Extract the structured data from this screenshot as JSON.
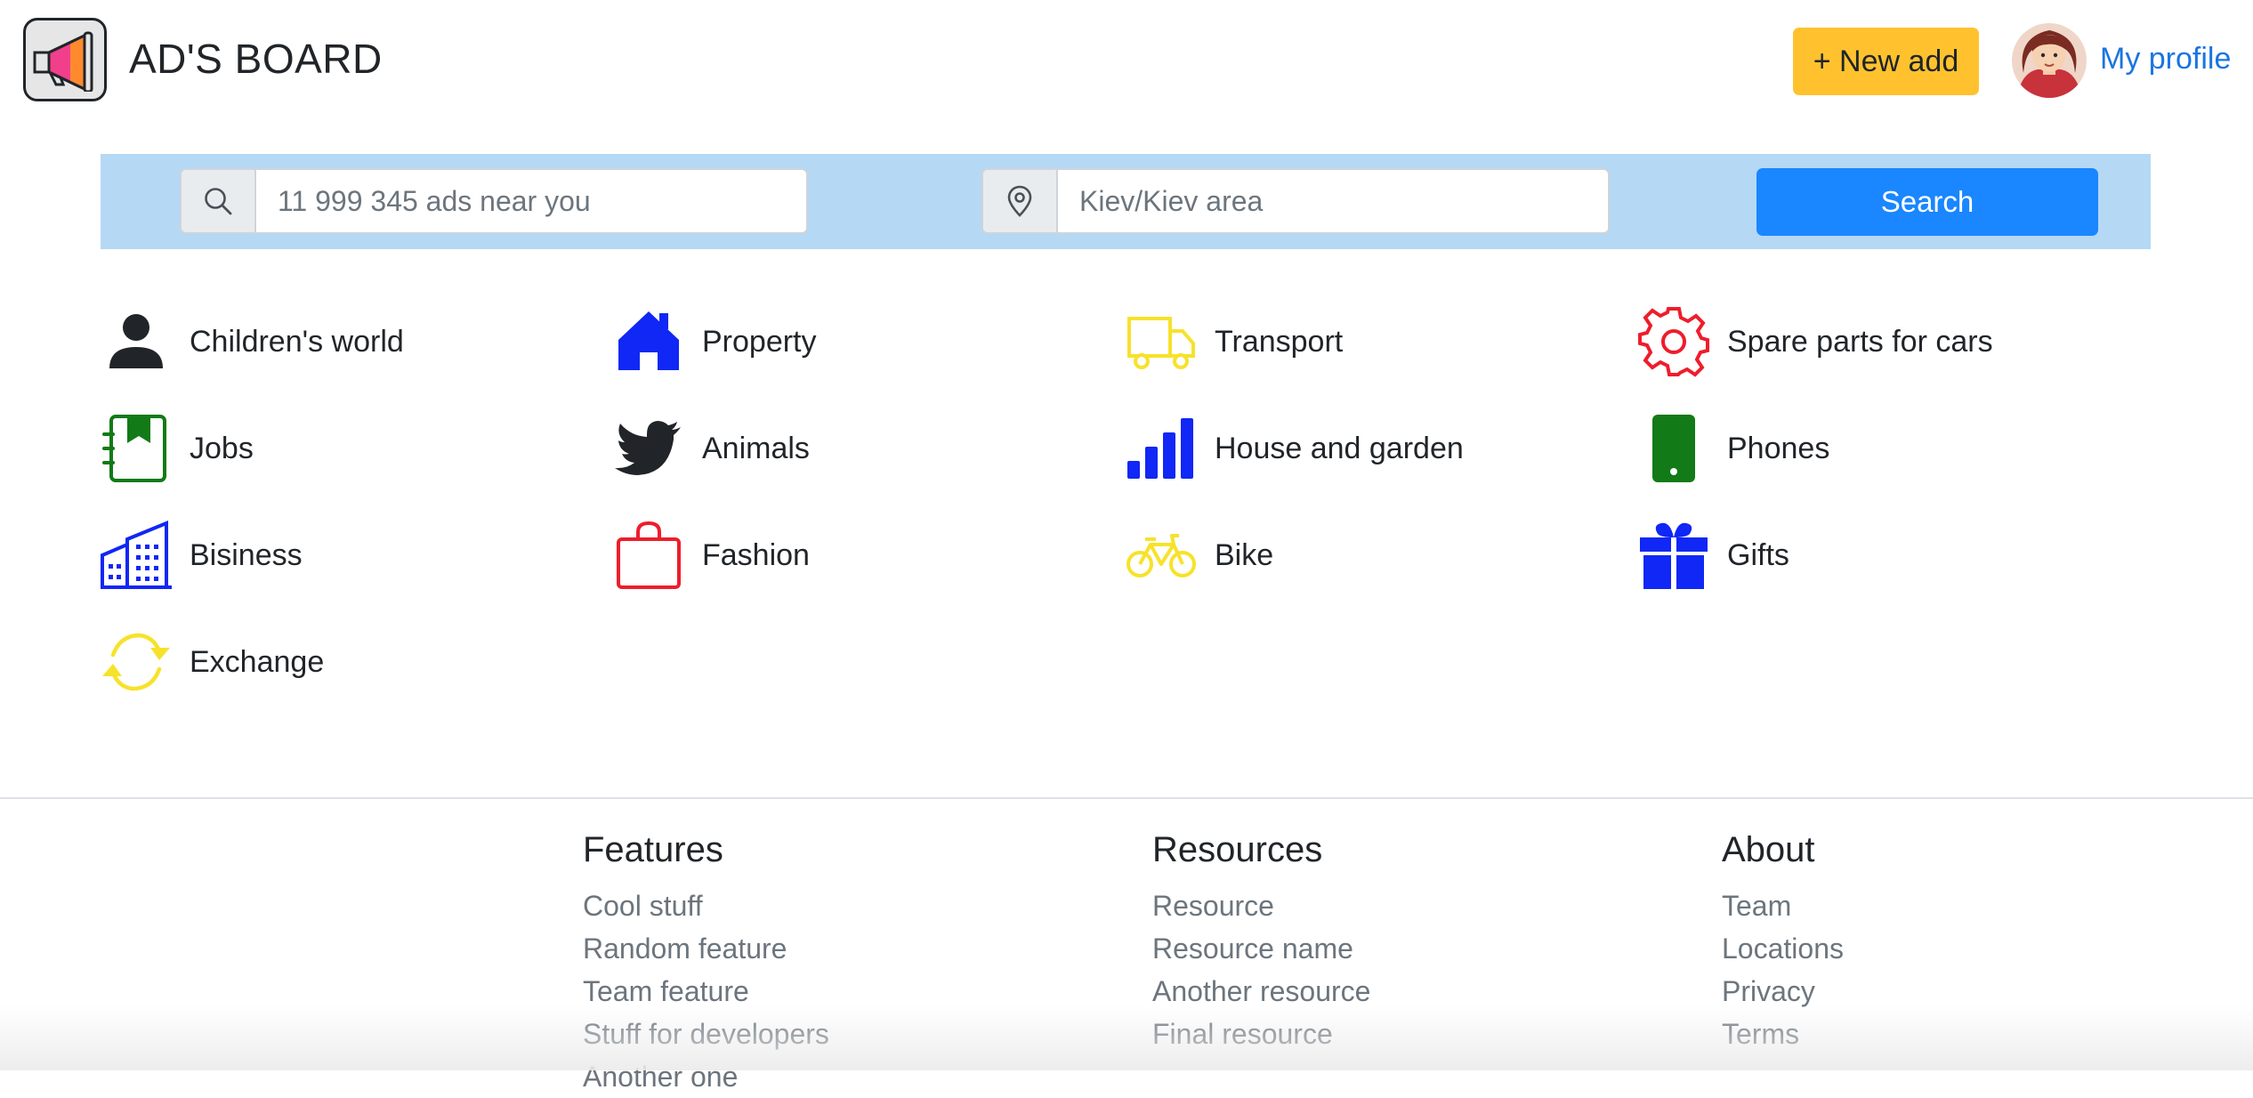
{
  "header": {
    "brand": "AD'S BOARD",
    "new_add_label": "+ New add",
    "profile_label": "My profile"
  },
  "search": {
    "query_placeholder": "11 999 345 ads near you",
    "location_placeholder": "Kiev/Kiev area",
    "button_label": "Search"
  },
  "categories": [
    {
      "label": "Children's world",
      "icon": "person-icon",
      "color": "#212529"
    },
    {
      "label": "Property",
      "icon": "house-icon",
      "color": "#1027f5"
    },
    {
      "label": "Transport",
      "icon": "truck-icon",
      "color": "#f7e22b"
    },
    {
      "label": "Spare parts for cars",
      "icon": "gear-icon",
      "color": "#ee1d2c"
    },
    {
      "label": "Jobs",
      "icon": "journal-bookmark-icon",
      "color": "#127a17"
    },
    {
      "label": "Animals",
      "icon": "bird-icon",
      "color": "#212529"
    },
    {
      "label": "House and garden",
      "icon": "bar-chart-icon",
      "color": "#1027f5"
    },
    {
      "label": "Phones",
      "icon": "phone-icon",
      "color": "#127a17"
    },
    {
      "label": "Bisiness",
      "icon": "buildings-icon",
      "color": "#1027f5"
    },
    {
      "label": "Fashion",
      "icon": "shopping-bag-icon",
      "color": "#ee1d2c"
    },
    {
      "label": "Bike",
      "icon": "bicycle-icon",
      "color": "#f7e22b"
    },
    {
      "label": "Gifts",
      "icon": "gift-icon",
      "color": "#1027f5"
    },
    {
      "label": "Exchange",
      "icon": "arrows-cycle-icon",
      "color": "#f7e22b"
    }
  ],
  "footer": {
    "features": {
      "title": "Features",
      "links": [
        "Cool stuff",
        "Random feature",
        "Team feature",
        "Stuff for developers",
        "Another one"
      ]
    },
    "resources": {
      "title": "Resources",
      "links": [
        "Resource",
        "Resource name",
        "Another resource",
        "Final resource"
      ]
    },
    "about": {
      "title": "About",
      "links": [
        "Team",
        "Locations",
        "Privacy",
        "Terms"
      ]
    }
  },
  "colors": {
    "accent_yellow": "#ffc22e",
    "primary_blue": "#1a86ff",
    "search_band": "#b5d8f5",
    "link_blue": "#1a75e0"
  }
}
